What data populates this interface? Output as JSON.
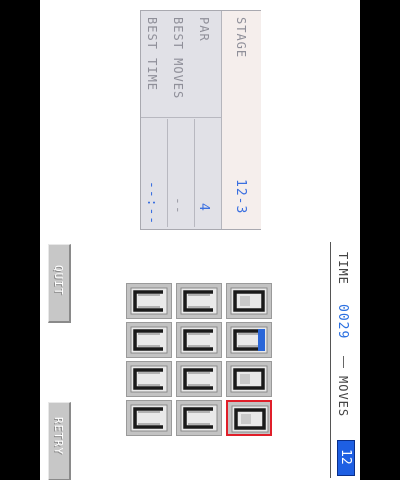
{
  "stats": {
    "stage_label": "STAGE",
    "stage_value": "12-3",
    "par_label": "PAR",
    "par_value": "4",
    "best_moves_label": "BEST MOVES",
    "best_moves_value": "--",
    "best_time_label": "BEST TIME",
    "best_time_value": "--:--"
  },
  "hud": {
    "time_label": "TIME",
    "time_value": "0029",
    "moves_label": "MOVES",
    "moves_value": "12"
  },
  "buttons": {
    "quit_label": "QUIT",
    "retry_label": "RETRY"
  },
  "board": {
    "rows": 4,
    "cols": 3,
    "cells": [
      {
        "shape": "cup",
        "selected": false
      },
      {
        "shape": "cup",
        "selected": false
      },
      {
        "shape": "ring",
        "selected": false
      },
      {
        "shape": "cup",
        "selected": false
      },
      {
        "shape": "cup",
        "selected": false
      },
      {
        "shape": "cup-blue",
        "selected": false
      },
      {
        "shape": "cup",
        "selected": false
      },
      {
        "shape": "cup",
        "selected": false
      },
      {
        "shape": "ring",
        "selected": false
      },
      {
        "shape": "cup",
        "selected": false
      },
      {
        "shape": "cup",
        "selected": false
      },
      {
        "shape": "ring",
        "selected": true
      }
    ],
    "colors": {
      "tile_face": "#e9e9e9",
      "tile_ink": "#1a1a1a",
      "highlight": "#2a66d8",
      "selected": "#e01f2a"
    }
  }
}
